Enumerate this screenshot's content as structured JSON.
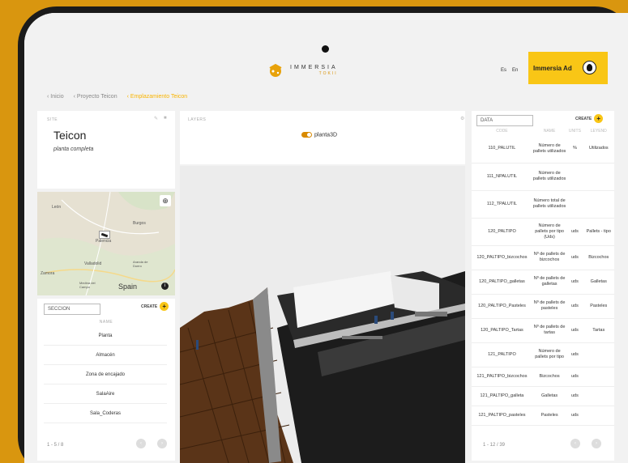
{
  "app": {
    "brand": "IMMERSIA",
    "brand_sub": "TOKII"
  },
  "header": {
    "lang_es": "Es",
    "lang_en": "En",
    "user_name": "Immersia Ad"
  },
  "breadcrumb": [
    "Inicio",
    "Proyecto Teicon",
    "Emplazamiento Teicon"
  ],
  "site": {
    "label": "SITE",
    "title": "Teicon",
    "subtitle": "planta completa"
  },
  "map": {
    "places": [
      "León",
      "Burgos",
      "Palencia",
      "Valladolid",
      "Aranda de Duero",
      "Zamora",
      "Medina del Campo",
      "Spain"
    ]
  },
  "secciones": {
    "search_placeholder": "SECCION",
    "create_label": "CREATE",
    "column_header": "NAME",
    "items": [
      "Planta",
      "Almacén",
      "Zona de encajado",
      "SalaAire",
      "Sala_Coderas"
    ],
    "pagination": "1 - 5 / 8"
  },
  "layers": {
    "label": "LAYERS",
    "item": "planta3D"
  },
  "data_panel": {
    "search_placeholder": "DATA",
    "create_label": "CREATE",
    "columns": [
      "CODE",
      "NAME",
      "UNITS",
      "LEYEND"
    ],
    "rows": [
      [
        "110_PALUTIL",
        "Número de pallets utilizados",
        "%",
        "Utilizados"
      ],
      [
        "111_NPALUTIL",
        "Número de pallets utilizados",
        "",
        ""
      ],
      [
        "112_TPALUTIL",
        "Número total de pallets utilizados",
        "",
        ""
      ],
      [
        "120_PALTIPO",
        "Número de pallets por tipo (Uds)",
        "uds",
        "Pallets - tipo"
      ],
      [
        "120_PALTIPO_bizcochos",
        "Nº de pallets de bizcochos",
        "uds",
        "Bizcochos"
      ],
      [
        "120_PALTIPO_galletas",
        "Nº de pallets de galletas",
        "uds",
        "Galletas"
      ],
      [
        "120_PALTIPO_Pasteles",
        "Nº de pallets de pasteles",
        "uds",
        "Pasteles"
      ],
      [
        "120_PALTIPO_Tartas",
        "Nº de pallets de tartas",
        "uds",
        "Tartas"
      ],
      [
        "121_PALTIPO",
        "Número de pallets por tipo",
        "uds",
        ""
      ],
      [
        "121_PALTIPO_bizcochos",
        "Bizcochos",
        "uds",
        ""
      ],
      [
        "121_PALTIPO_galleta",
        "Galletas",
        "uds",
        ""
      ],
      [
        "121_PALTIPO_pasteles",
        "Pasteles",
        "uds",
        ""
      ]
    ],
    "pagination": "1 - 12 / 39"
  },
  "colors": {
    "accent": "#F9C616",
    "background": "#D9960F",
    "link_active": "#F9B400"
  }
}
